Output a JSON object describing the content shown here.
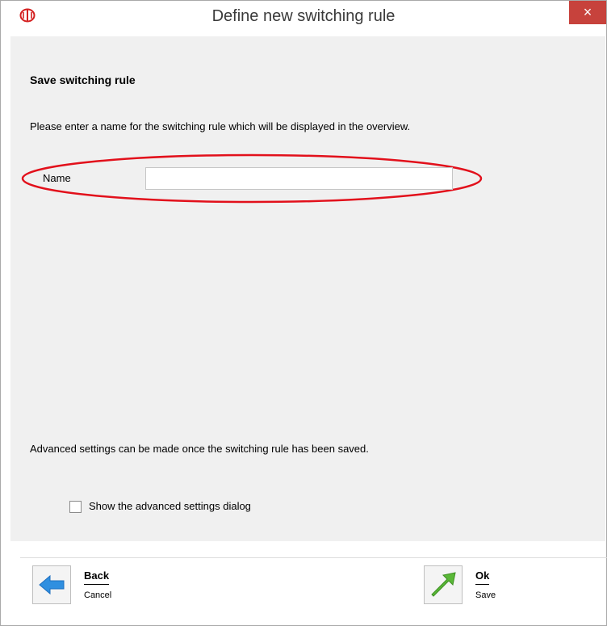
{
  "window": {
    "title": "Define new switching rule",
    "close_label": "×"
  },
  "form": {
    "heading": "Save switching rule",
    "description": "Please enter a name for the switching rule which will be displayed in the overview.",
    "name_label": "Name",
    "name_value": "",
    "advanced_note": "Advanced settings can be made once the switching rule has been saved.",
    "show_advanced_label": "Show the advanced settings dialog",
    "show_advanced_checked": false
  },
  "footer": {
    "back_label": "Back",
    "back_sub": "Cancel",
    "ok_label": "Ok",
    "ok_sub": "Save"
  },
  "colors": {
    "close_button": "#c7423c",
    "highlight_ellipse": "#e2101b",
    "back_arrow": "#2f8fe0",
    "ok_arrow": "#5ab838"
  },
  "icons": {
    "app": "app-logo-icon",
    "back": "arrow-left-icon",
    "ok": "arrow-up-right-icon"
  }
}
